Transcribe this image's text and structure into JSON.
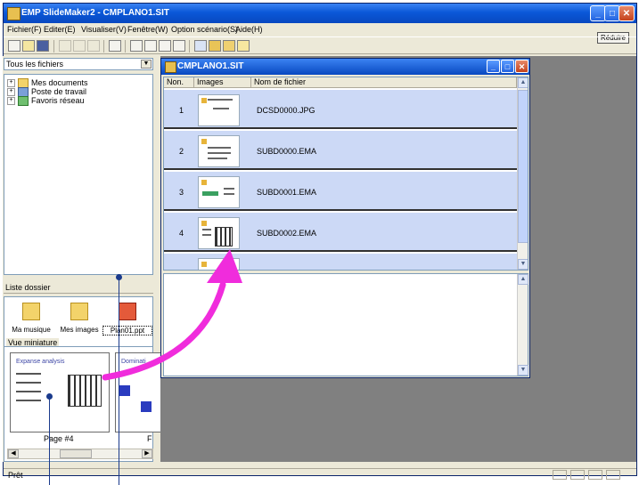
{
  "window": {
    "title": "EMP SlideMaker2 - CMPLANO1.SIT",
    "reduce_label": "Réduire"
  },
  "menu": [
    "Fichier(F)",
    "Editer(E)",
    "Visualiser(V)",
    "Fenêtre(W)",
    "Option scénario(S)",
    "Aide(H)"
  ],
  "left_pane": {
    "drive_select": "Tous les fichiers",
    "tree": [
      "Mes documents",
      "Poste de travail",
      "Favoris réseau"
    ],
    "list_label": "Liste dossier",
    "folder_items": [
      "Ma musique",
      "Mes images",
      "Plan01.ppt"
    ],
    "miniature_label": "Vue miniature",
    "thumbnails": [
      {
        "heading": "Expanse analysis",
        "page": "Page #4"
      },
      {
        "heading": "Dominati",
        "page": "F"
      }
    ]
  },
  "child_window": {
    "title": "CMPLANO1.SIT",
    "columns": [
      "Non.",
      "Images",
      "Nom de fichier"
    ],
    "rows": [
      {
        "num": "1",
        "file": "DCSD0000.JPG"
      },
      {
        "num": "2",
        "file": "SUBD0000.EMA"
      },
      {
        "num": "3",
        "file": "SUBD0001.EMA"
      },
      {
        "num": "4",
        "file": "SUBD0002.EMA"
      }
    ]
  },
  "status": {
    "text": "Prêt"
  },
  "colors": {
    "title_blue": "#0a58d8",
    "row_selected": "#ccd9f6",
    "arrow": "#f02cdc",
    "callout": "#1a3a8c",
    "mdi_gray": "#808080"
  },
  "icons": [
    "new-icon",
    "open-icon",
    "save-icon",
    "cut-icon",
    "copy-icon",
    "paste-icon",
    "print-icon",
    "view-icon",
    "grid-icon",
    "monitor-icon",
    "projector-icon",
    "help-icon"
  ]
}
